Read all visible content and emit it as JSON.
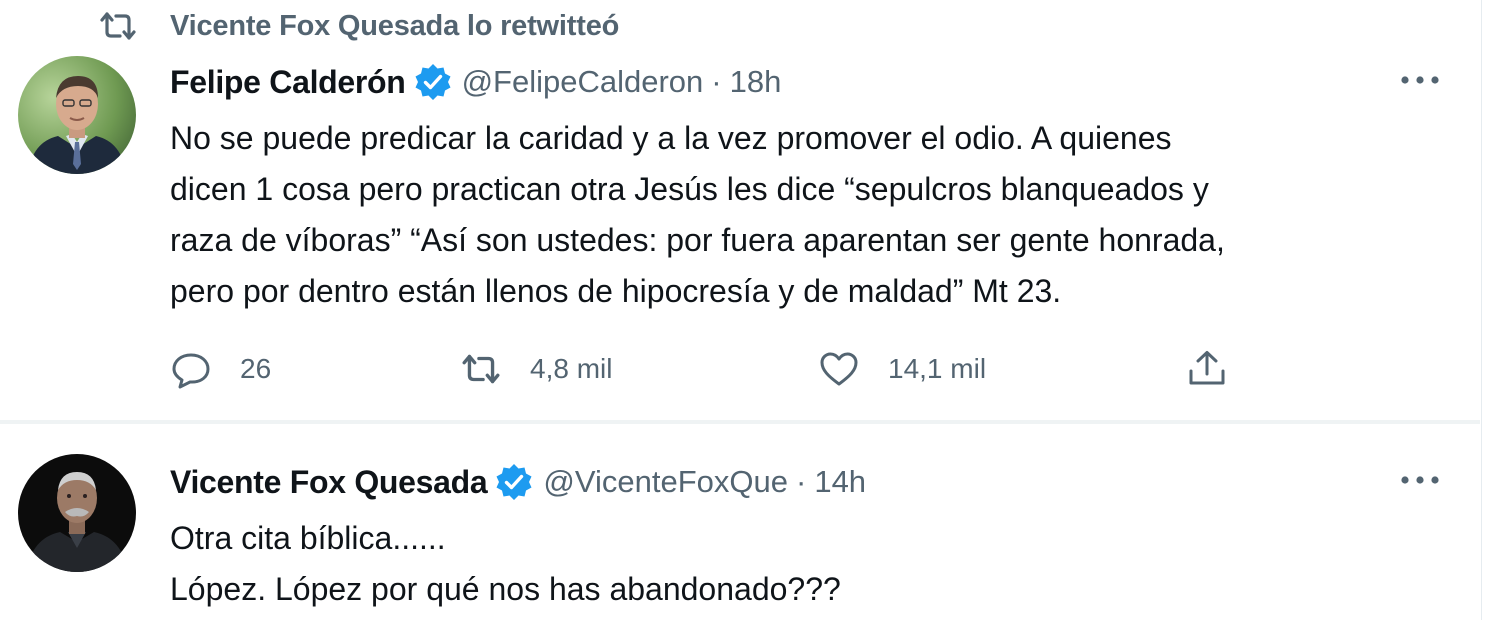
{
  "retweet_context": {
    "text": "Vicente Fox Quesada lo retwitteó",
    "icon": "retweet-icon"
  },
  "tweets": [
    {
      "author_name": "Felipe Calderón",
      "handle": "@FelipeCalderon",
      "separator": "·",
      "time": "18h",
      "verified": true,
      "text_lines": [
        "No se puede predicar la caridad y a la vez promover el odio. A quienes",
        "dicen 1 cosa pero practican otra Jesús les dice “sepulcros blanqueados y",
        "raza de víboras” “Así son ustedes: por fuera aparentan ser gente honrada,",
        "pero por dentro están llenos de hipocresía y de maldad” Mt 23."
      ],
      "actions": {
        "replies": "26",
        "retweets": "4,8 mil",
        "likes": "14,1 mil"
      }
    },
    {
      "author_name": "Vicente Fox Quesada",
      "handle": "@VicenteFoxQue",
      "separator": "·",
      "time": "14h",
      "verified": true,
      "text_lines": [
        "Otra cita bíblica......",
        "López. López por qué nos has abandonado???"
      ]
    }
  ],
  "colors": {
    "text": "#0f1419",
    "secondary": "#536471",
    "verified": "#1d9bf0",
    "divider": "#eff3f4"
  }
}
